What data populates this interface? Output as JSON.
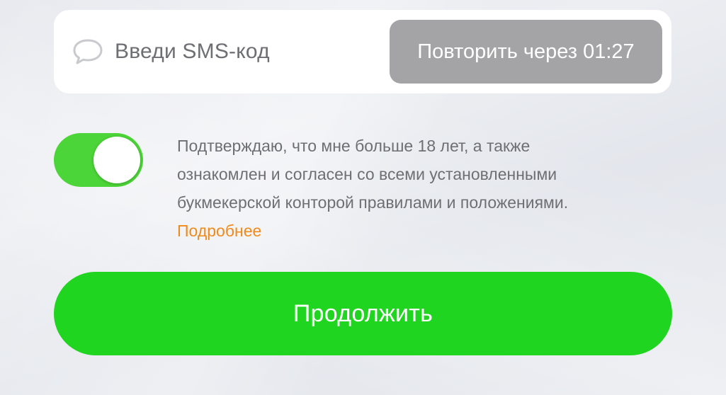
{
  "sms": {
    "placeholder": "Введи SMS-код",
    "icon": "chat-bubble-icon",
    "resend_label": "Повторить через 01:27"
  },
  "agreement": {
    "toggle_on": true,
    "lines": [
      "Подтверждаю, что мне больше 18 лет, а также",
      "ознакомлен и согласен со всеми установленными",
      "букмекерской конторой правилами и положениями."
    ],
    "more_link": "Подробнее"
  },
  "actions": {
    "continue_label": "Продолжить"
  },
  "colors": {
    "accent_green": "#1fd51f",
    "toggle_green": "#4cd538",
    "link_orange": "#f08a1c",
    "disabled_gray": "#a4a4a6"
  }
}
